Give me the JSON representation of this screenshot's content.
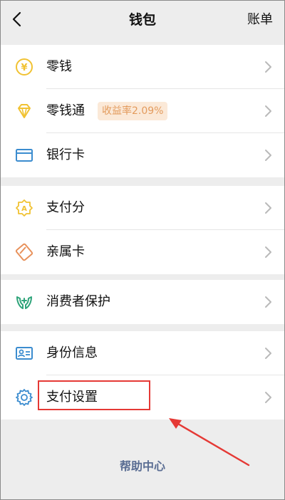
{
  "header": {
    "title": "钱包",
    "right_action": "账单",
    "back_icon": "chevron-left-icon"
  },
  "sections": [
    {
      "items": [
        {
          "label": "零钱",
          "icon": "coin-yuan-icon",
          "color": "#f1c232"
        },
        {
          "label": "零钱通",
          "icon": "diamond-icon",
          "color": "#f1c232",
          "badge": "收益率2.09%"
        },
        {
          "label": "银行卡",
          "icon": "card-icon",
          "color": "#3b8ccf"
        }
      ]
    },
    {
      "items": [
        {
          "label": "支付分",
          "icon": "score-badge-icon",
          "color": "#f1c232"
        },
        {
          "label": "亲属卡",
          "icon": "family-card-icon",
          "color": "#e8915b"
        }
      ]
    },
    {
      "items": [
        {
          "label": "消费者保护",
          "icon": "hands-protect-icon",
          "color": "#2fa47a"
        }
      ]
    },
    {
      "items": [
        {
          "label": "身份信息",
          "icon": "id-card-icon",
          "color": "#3b8ccf"
        },
        {
          "label": "支付设置",
          "icon": "gear-icon",
          "color": "#3b8ccf"
        }
      ]
    }
  ],
  "footer": {
    "help_center": "帮助中心"
  },
  "annotation": {
    "highlight_color": "#e53935"
  }
}
